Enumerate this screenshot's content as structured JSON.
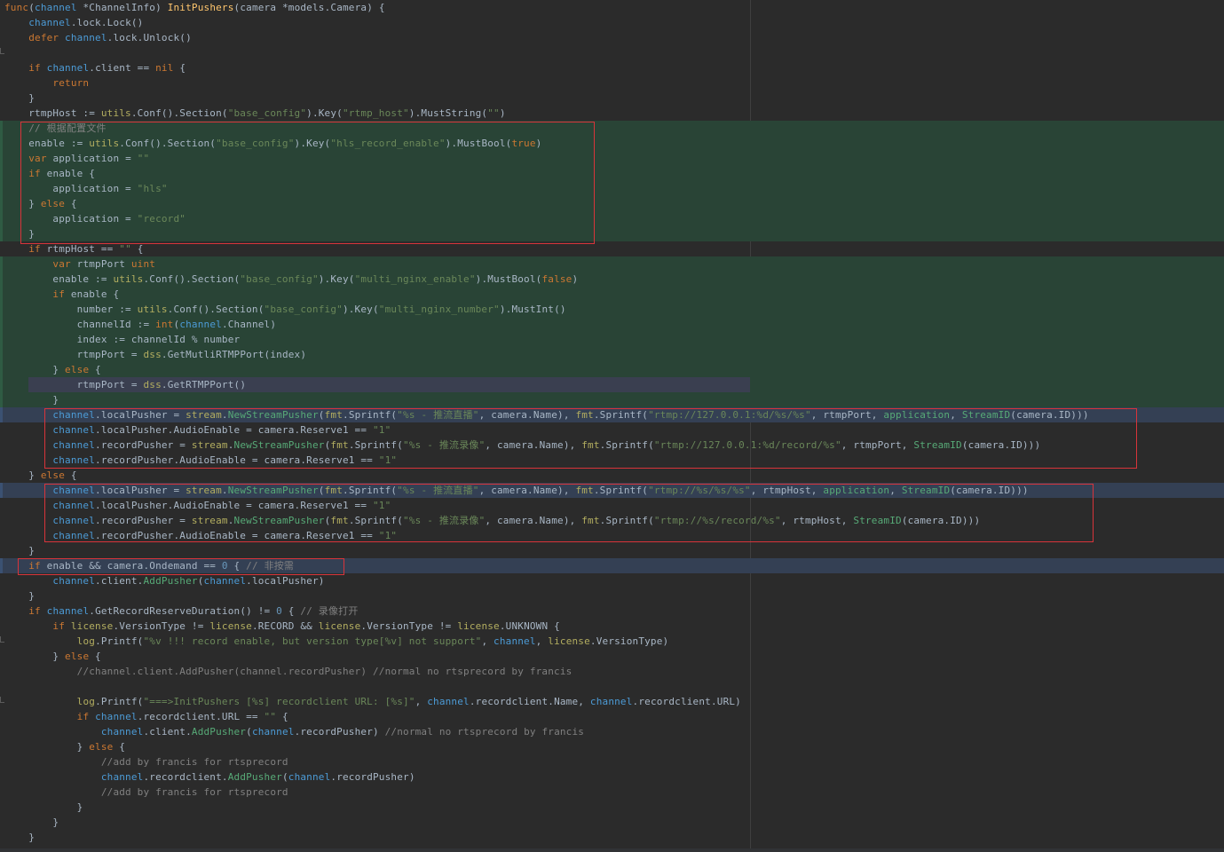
{
  "editor": {
    "colors": {
      "background": "#2b2b2b",
      "text": "#a9b7c6",
      "keyword": "#cc7832",
      "function": "#ffc66d",
      "string": "#6a8759",
      "number": "#6897bb",
      "comment": "#808080",
      "package": "#b3ae60",
      "receiver": "#4c9bd6",
      "changed_block": "#294436",
      "highlight_box": "#d8343a"
    },
    "lines": [
      [
        [
          "kw",
          "func"
        ],
        [
          "",
          "("
        ],
        [
          "rcv",
          "channel"
        ],
        [
          "",
          " *"
        ],
        [
          "typ",
          "ChannelInfo"
        ],
        [
          "",
          ") "
        ],
        [
          "fn",
          "InitPushers"
        ],
        [
          "",
          "(camera *"
        ],
        [
          "typ",
          "models"
        ],
        [
          "",
          ".Camera) {"
        ]
      ],
      [
        [
          "",
          "    "
        ],
        [
          "rcv",
          "channel"
        ],
        [
          "",
          ".lock.Lock()"
        ]
      ],
      [
        [
          "",
          "    "
        ],
        [
          "kw",
          "defer "
        ],
        [
          "rcv",
          "channel"
        ],
        [
          "",
          ".lock.Unlock()"
        ]
      ],
      [],
      [
        [
          "",
          "    "
        ],
        [
          "kw",
          "if "
        ],
        [
          "rcv",
          "channel"
        ],
        [
          "",
          ".client == "
        ],
        [
          "kw",
          "nil"
        ],
        [
          "",
          " {"
        ]
      ],
      [
        [
          "",
          "        "
        ],
        [
          "kw",
          "return"
        ]
      ],
      [
        [
          "",
          "    }"
        ]
      ],
      [
        [
          "",
          "    rtmpHost := "
        ],
        [
          "pkg",
          "utils"
        ],
        [
          "",
          ".Conf().Section("
        ],
        [
          "str",
          "\"base_config\""
        ],
        [
          "",
          ").Key("
        ],
        [
          "str",
          "\"rtmp_host\""
        ],
        [
          "",
          ").MustString("
        ],
        [
          "str",
          "\"\""
        ],
        [
          "",
          ")"
        ]
      ],
      [
        [
          "",
          "    "
        ],
        [
          "cmt",
          "// 根据配置文件"
        ]
      ],
      [
        [
          "",
          "    enable := "
        ],
        [
          "pkg",
          "utils"
        ],
        [
          "",
          ".Conf().Section("
        ],
        [
          "str",
          "\"base_config\""
        ],
        [
          "",
          ").Key("
        ],
        [
          "str",
          "\"hls_record_enable\""
        ],
        [
          "",
          ").MustBool("
        ],
        [
          "kw",
          "true"
        ],
        [
          "",
          ")"
        ]
      ],
      [
        [
          "",
          "    "
        ],
        [
          "kw",
          "var "
        ],
        [
          "",
          "application = "
        ],
        [
          "str",
          "\"\""
        ]
      ],
      [
        [
          "",
          "    "
        ],
        [
          "kw",
          "if "
        ],
        [
          "",
          "enable {"
        ]
      ],
      [
        [
          "",
          "        application = "
        ],
        [
          "str",
          "\"hls\""
        ]
      ],
      [
        [
          "",
          "    } "
        ],
        [
          "kw",
          "else"
        ],
        [
          "",
          " {"
        ]
      ],
      [
        [
          "",
          "        application = "
        ],
        [
          "str",
          "\"record\""
        ]
      ],
      [
        [
          "",
          "    }"
        ]
      ],
      [
        [
          "",
          "    "
        ],
        [
          "kw",
          "if "
        ],
        [
          "",
          "rtmpHost == "
        ],
        [
          "str",
          "\"\""
        ],
        [
          "",
          " {"
        ]
      ],
      [
        [
          "",
          "        "
        ],
        [
          "kw",
          "var "
        ],
        [
          "",
          "rtmpPort "
        ],
        [
          "kw",
          "uint"
        ]
      ],
      [
        [
          "",
          "        enable := "
        ],
        [
          "pkg",
          "utils"
        ],
        [
          "",
          ".Conf().Section("
        ],
        [
          "str",
          "\"base_config\""
        ],
        [
          "",
          ").Key("
        ],
        [
          "str",
          "\"multi_nginx_enable\""
        ],
        [
          "",
          ").MustBool("
        ],
        [
          "kw",
          "false"
        ],
        [
          "",
          ")"
        ]
      ],
      [
        [
          "",
          "        "
        ],
        [
          "kw",
          "if "
        ],
        [
          "",
          "enable {"
        ]
      ],
      [
        [
          "",
          "            number := "
        ],
        [
          "pkg",
          "utils"
        ],
        [
          "",
          ".Conf().Section("
        ],
        [
          "str",
          "\"base_config\""
        ],
        [
          "",
          ").Key("
        ],
        [
          "str",
          "\"multi_nginx_number\""
        ],
        [
          "",
          ").MustInt()"
        ]
      ],
      [
        [
          "",
          "            channelId := "
        ],
        [
          "kw",
          "int"
        ],
        [
          "",
          "("
        ],
        [
          "rcv",
          "channel"
        ],
        [
          "",
          ".Channel)"
        ]
      ],
      [
        [
          "",
          "            index := channelId % number"
        ]
      ],
      [
        [
          "",
          "            rtmpPort = "
        ],
        [
          "pkg",
          "dss"
        ],
        [
          "",
          ".GetMutliRTMPPort(index)"
        ]
      ],
      [
        [
          "",
          "        } "
        ],
        [
          "kw",
          "else"
        ],
        [
          "",
          " {"
        ]
      ],
      [
        [
          "",
          "            rtmpPort = "
        ],
        [
          "pkg",
          "dss"
        ],
        [
          "",
          ".GetRTMPPort()"
        ]
      ],
      [
        [
          "",
          "        }"
        ]
      ],
      [
        [
          "",
          "        "
        ],
        [
          "rcv",
          "channel"
        ],
        [
          "",
          ".localPusher = "
        ],
        [
          "pkg",
          "stream"
        ],
        [
          "",
          "."
        ],
        [
          "mtd",
          "NewStreamPusher"
        ],
        [
          "",
          "("
        ],
        [
          "pkg",
          "fmt"
        ],
        [
          "",
          ".Sprintf("
        ],
        [
          "str",
          "\"%s - 推流直播\""
        ],
        [
          "",
          ", camera.Name), "
        ],
        [
          "pkg",
          "fmt"
        ],
        [
          "",
          ".Sprintf("
        ],
        [
          "str",
          "\"rtmp://127.0.0.1:%d/%s/%s\""
        ],
        [
          "",
          ", rtmpPort, "
        ],
        [
          "mtd",
          "application"
        ],
        [
          "",
          ", "
        ],
        [
          "mtd",
          "StreamID"
        ],
        [
          "",
          "(camera.ID)))"
        ]
      ],
      [
        [
          "",
          "        "
        ],
        [
          "rcv",
          "channel"
        ],
        [
          "",
          ".localPusher.AudioEnable = camera.Reserve1 == "
        ],
        [
          "str",
          "\"1\""
        ]
      ],
      [
        [
          "",
          "        "
        ],
        [
          "rcv",
          "channel"
        ],
        [
          "",
          ".recordPusher = "
        ],
        [
          "pkg",
          "stream"
        ],
        [
          "",
          "."
        ],
        [
          "mtd",
          "NewStreamPusher"
        ],
        [
          "",
          "("
        ],
        [
          "pkg",
          "fmt"
        ],
        [
          "",
          ".Sprintf("
        ],
        [
          "str",
          "\"%s - 推流录像\""
        ],
        [
          "",
          ", camera.Name), "
        ],
        [
          "pkg",
          "fmt"
        ],
        [
          "",
          ".Sprintf("
        ],
        [
          "str",
          "\"rtmp://127.0.0.1:%d/record/%s\""
        ],
        [
          "",
          ", rtmpPort, "
        ],
        [
          "mtd",
          "StreamID"
        ],
        [
          "",
          "(camera.ID)))"
        ]
      ],
      [
        [
          "",
          "        "
        ],
        [
          "rcv",
          "channel"
        ],
        [
          "",
          ".recordPusher.AudioEnable = camera.Reserve1 == "
        ],
        [
          "str",
          "\"1\""
        ]
      ],
      [
        [
          "",
          "    } "
        ],
        [
          "kw",
          "else"
        ],
        [
          "",
          " {"
        ]
      ],
      [
        [
          "",
          "        "
        ],
        [
          "rcv",
          "channel"
        ],
        [
          "",
          ".localPusher = "
        ],
        [
          "pkg",
          "stream"
        ],
        [
          "",
          "."
        ],
        [
          "mtd",
          "NewStreamPusher"
        ],
        [
          "",
          "("
        ],
        [
          "pkg",
          "fmt"
        ],
        [
          "",
          ".Sprintf("
        ],
        [
          "str",
          "\"%s - 推流直播\""
        ],
        [
          "",
          ", camera.Name), "
        ],
        [
          "pkg",
          "fmt"
        ],
        [
          "",
          ".Sprintf("
        ],
        [
          "str",
          "\"rtmp://%s/%s/%s\""
        ],
        [
          "",
          ", rtmpHost, "
        ],
        [
          "mtd",
          "application"
        ],
        [
          "",
          ", "
        ],
        [
          "mtd",
          "StreamID"
        ],
        [
          "",
          "(camera.ID)))"
        ]
      ],
      [
        [
          "",
          "        "
        ],
        [
          "rcv",
          "channel"
        ],
        [
          "",
          ".localPusher.AudioEnable = camera.Reserve1 == "
        ],
        [
          "str",
          "\"1\""
        ]
      ],
      [
        [
          "",
          "        "
        ],
        [
          "rcv",
          "channel"
        ],
        [
          "",
          ".recordPusher = "
        ],
        [
          "pkg",
          "stream"
        ],
        [
          "",
          "."
        ],
        [
          "mtd",
          "NewStreamPusher"
        ],
        [
          "",
          "("
        ],
        [
          "pkg",
          "fmt"
        ],
        [
          "",
          ".Sprintf("
        ],
        [
          "str",
          "\"%s - 推流录像\""
        ],
        [
          "",
          ", camera.Name), "
        ],
        [
          "pkg",
          "fmt"
        ],
        [
          "",
          ".Sprintf("
        ],
        [
          "str",
          "\"rtmp://%s/record/%s\""
        ],
        [
          "",
          ", rtmpHost, "
        ],
        [
          "mtd",
          "StreamID"
        ],
        [
          "",
          "(camera.ID)))"
        ]
      ],
      [
        [
          "",
          "        "
        ],
        [
          "rcv",
          "channel"
        ],
        [
          "",
          ".recordPusher.AudioEnable = camera.Reserve1 == "
        ],
        [
          "str",
          "\"1\""
        ]
      ],
      [
        [
          "",
          "    }"
        ]
      ],
      [
        [
          "",
          "    "
        ],
        [
          "kw",
          "if "
        ],
        [
          "",
          "enable && camera.Ondemand == "
        ],
        [
          "num",
          "0"
        ],
        [
          "",
          " { "
        ],
        [
          "cmt",
          "// 非按需"
        ]
      ],
      [
        [
          "",
          "        "
        ],
        [
          "rcv",
          "channel"
        ],
        [
          "",
          ".client."
        ],
        [
          "mtd",
          "AddPusher"
        ],
        [
          "",
          "("
        ],
        [
          "rcv",
          "channel"
        ],
        [
          "",
          ".localPusher)"
        ]
      ],
      [
        [
          "",
          "    }"
        ]
      ],
      [
        [
          "",
          "    "
        ],
        [
          "kw",
          "if "
        ],
        [
          "rcv",
          "channel"
        ],
        [
          "",
          ".GetRecordReserveDuration() != "
        ],
        [
          "num",
          "0"
        ],
        [
          "",
          " { "
        ],
        [
          "cmt",
          "// 录像打开"
        ]
      ],
      [
        [
          "",
          "        "
        ],
        [
          "kw",
          "if "
        ],
        [
          "pkg",
          "license"
        ],
        [
          "",
          ".VersionType != "
        ],
        [
          "pkg",
          "license"
        ],
        [
          "",
          ".RECORD && "
        ],
        [
          "pkg",
          "license"
        ],
        [
          "",
          ".VersionType != "
        ],
        [
          "pkg",
          "license"
        ],
        [
          "",
          ".UNKNOWN {"
        ]
      ],
      [
        [
          "",
          "            "
        ],
        [
          "pkg",
          "log"
        ],
        [
          "",
          ".Printf("
        ],
        [
          "str",
          "\"%v !!! record enable, but version type[%v] not support\""
        ],
        [
          "",
          ", "
        ],
        [
          "rcv",
          "channel"
        ],
        [
          "",
          ", "
        ],
        [
          "pkg",
          "license"
        ],
        [
          "",
          ".VersionType)"
        ]
      ],
      [
        [
          "",
          "        } "
        ],
        [
          "kw",
          "else"
        ],
        [
          "",
          " {"
        ]
      ],
      [
        [
          "",
          "            "
        ],
        [
          "cmt",
          "//channel.client.AddPusher(channel.recordPusher) //normal no rtsprecord by francis"
        ]
      ],
      [],
      [
        [
          "",
          "            "
        ],
        [
          "pkg",
          "log"
        ],
        [
          "",
          ".Printf("
        ],
        [
          "str",
          "\"===>InitPushers [%s] recordclient URL: [%s]\""
        ],
        [
          "",
          ", "
        ],
        [
          "rcv",
          "channel"
        ],
        [
          "",
          ".recordclient.Name, "
        ],
        [
          "rcv",
          "channel"
        ],
        [
          "",
          ".recordclient.URL)"
        ]
      ],
      [
        [
          "",
          "            "
        ],
        [
          "kw",
          "if "
        ],
        [
          "rcv",
          "channel"
        ],
        [
          "",
          ".recordclient.URL == "
        ],
        [
          "str",
          "\"\""
        ],
        [
          "",
          " {"
        ]
      ],
      [
        [
          "",
          "                "
        ],
        [
          "rcv",
          "channel"
        ],
        [
          "",
          ".client."
        ],
        [
          "mtd",
          "AddPusher"
        ],
        [
          "",
          "("
        ],
        [
          "rcv",
          "channel"
        ],
        [
          "",
          ".recordPusher) "
        ],
        [
          "cmt",
          "//normal no rtsprecord by francis"
        ]
      ],
      [
        [
          "",
          "            } "
        ],
        [
          "kw",
          "else"
        ],
        [
          "",
          " {"
        ]
      ],
      [
        [
          "",
          "                "
        ],
        [
          "cmt",
          "//add by francis for rtsprecord"
        ]
      ],
      [
        [
          "",
          "                "
        ],
        [
          "rcv",
          "channel"
        ],
        [
          "",
          ".recordclient."
        ],
        [
          "mtd",
          "AddPusher"
        ],
        [
          "",
          "("
        ],
        [
          "rcv",
          "channel"
        ],
        [
          "",
          ".recordPusher)"
        ]
      ],
      [
        [
          "",
          "                "
        ],
        [
          "cmt",
          "//add by francis for rtsprecord"
        ]
      ],
      [
        [
          "",
          "            }"
        ]
      ],
      [
        [
          "",
          "        }"
        ]
      ],
      [
        [
          "",
          "    }"
        ]
      ]
    ]
  }
}
